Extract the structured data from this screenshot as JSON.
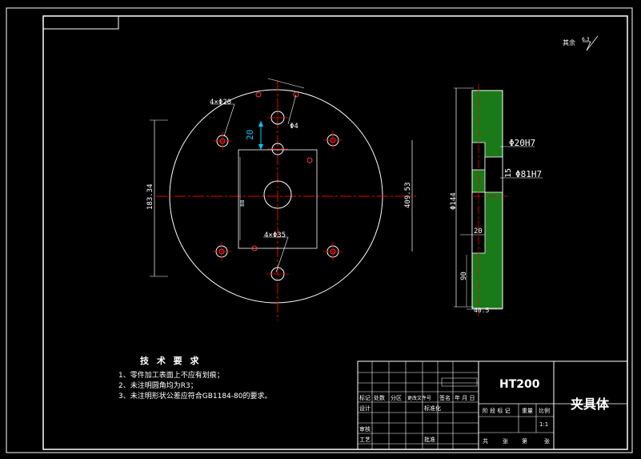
{
  "surface_note": {
    "label": "其余",
    "value": "6.3"
  },
  "plate_view": {
    "hole_4x_d20": "4×Φ20",
    "hole_d4": "Φ4",
    "hole_4x_d35": "4×Φ35",
    "dim_spacing_20": "20",
    "dim_vertical_183": "183.34",
    "dim_outer_409": "409.53",
    "dim_inner_88": "88"
  },
  "side_view": {
    "bore_d20": "Φ20H7",
    "bore_d81": "Φ81H7",
    "dim_15": "15",
    "dim_d144": "Φ144",
    "dim_20": "20",
    "dim_90": "90",
    "dim_bottom": "40.5"
  },
  "tech_requirements": {
    "title": "技 术 要 求",
    "items": [
      "1、零件加工表面上不应有划痕；",
      "2、未注明圆角均为R3；",
      "3、未注明形状公差应符合GB1184-80的要求。"
    ]
  },
  "title_block": {
    "material": "HT200",
    "part_name": "夹具体",
    "row_labels": [
      "标记",
      "处数",
      "分区",
      "更改文件号",
      "签名",
      "年 月 日"
    ],
    "design": "设计",
    "standardized": "标准化",
    "check": "审核",
    "process": "工艺",
    "approve": "批准",
    "stage_labels": [
      "阶 段 标 记",
      "重量",
      "比例"
    ],
    "scale": "1:1",
    "sheet_info": [
      "共",
      "张",
      "第",
      "张"
    ]
  }
}
